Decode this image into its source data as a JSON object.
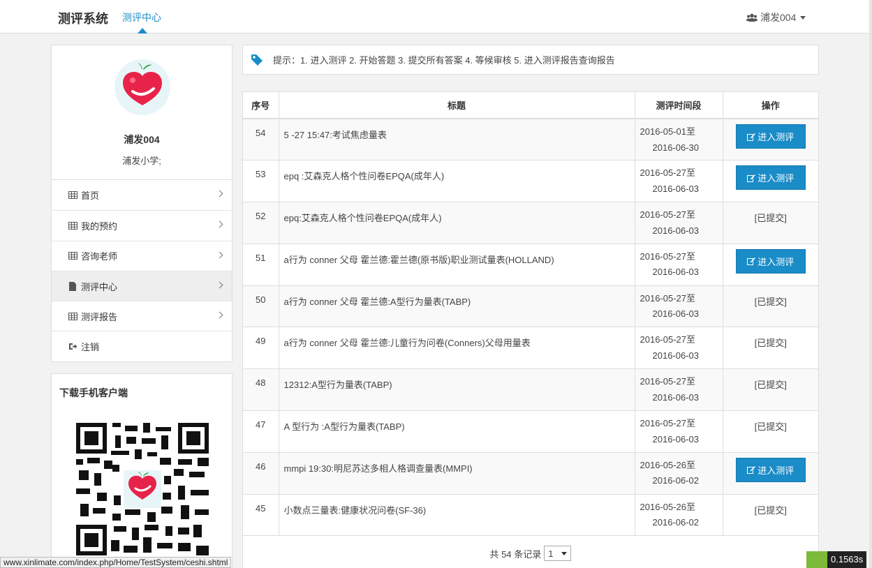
{
  "header": {
    "brand": "测评系统",
    "nav_active": "测评中心",
    "user": "浦发004",
    "user_icon": "users-icon"
  },
  "profile": {
    "name": "浦发004",
    "school": "浦发小学;"
  },
  "sidebar": {
    "items": [
      {
        "label": "首页",
        "icon": "grid-icon"
      },
      {
        "label": "我的预约",
        "icon": "grid-icon"
      },
      {
        "label": "咨询老师",
        "icon": "grid-icon"
      },
      {
        "label": "测评中心",
        "icon": "file-icon"
      },
      {
        "label": "测评报告",
        "icon": "grid-icon"
      },
      {
        "label": "注销",
        "icon": "sign-out-icon"
      }
    ]
  },
  "download": {
    "title": "下载手机客户端"
  },
  "tip": {
    "text": "提示：1. 进入测评 2. 开始答题 3. 提交所有答案 4. 等候审核 5. 进入测评报告查询报告"
  },
  "table": {
    "headers": [
      "序号",
      "标题",
      "测评时间段",
      "操作"
    ],
    "enter_label": "进入测评",
    "submitted_label": "[已提交]",
    "rows": [
      {
        "id": "54",
        "title": "5 -27 15:47:考试焦虑量表",
        "start": "2016-05-01至",
        "end": "2016-06-30",
        "action": "enter"
      },
      {
        "id": "53",
        "title": "epq :艾森克人格个性问卷EPQA(成年人)",
        "start": "2016-05-27至",
        "end": "2016-06-03",
        "action": "enter"
      },
      {
        "id": "52",
        "title": "epq:艾森克人格个性问卷EPQA(成年人)",
        "start": "2016-05-27至",
        "end": "2016-06-03",
        "action": "submitted"
      },
      {
        "id": "51",
        "title": "a行为 conner 父母 霍兰德:霍兰德(原书版)职业测试量表(HOLLAND)",
        "start": "2016-05-27至",
        "end": "2016-06-03",
        "action": "enter"
      },
      {
        "id": "50",
        "title": "a行为 conner 父母 霍兰德:A型行为量表(TABP)",
        "start": "2016-05-27至",
        "end": "2016-06-03",
        "action": "submitted"
      },
      {
        "id": "49",
        "title": "a行为 conner 父母 霍兰德:儿童行为问卷(Conners)父母用量表",
        "start": "2016-05-27至",
        "end": "2016-06-03",
        "action": "submitted"
      },
      {
        "id": "48",
        "title": "12312:A型行为量表(TABP)",
        "start": "2016-05-27至",
        "end": "2016-06-03",
        "action": "submitted"
      },
      {
        "id": "47",
        "title": "A 型行为 :A型行为量表(TABP)",
        "start": "2016-05-27至",
        "end": "2016-06-03",
        "action": "submitted"
      },
      {
        "id": "46",
        "title": "mmpi 19:30:明尼苏达多相人格调查量表(MMPI)",
        "start": "2016-05-26至",
        "end": "2016-06-02",
        "action": "enter"
      },
      {
        "id": "45",
        "title": "小数点三量表:健康状况问卷(SF-36)",
        "start": "2016-05-26至",
        "end": "2016-06-02",
        "action": "submitted"
      }
    ]
  },
  "pager": {
    "summary": "共 54 条记录",
    "page": "1"
  },
  "status_url": "www.xinlimate.com/index.php/Home/TestSystem/ceshi.shtml",
  "perf_time": "0.1563s",
  "colors": {
    "accent": "#1a8cc8",
    "border": "#dddddd",
    "heart": "#e8234a",
    "leaf": "#2e9e3e"
  }
}
